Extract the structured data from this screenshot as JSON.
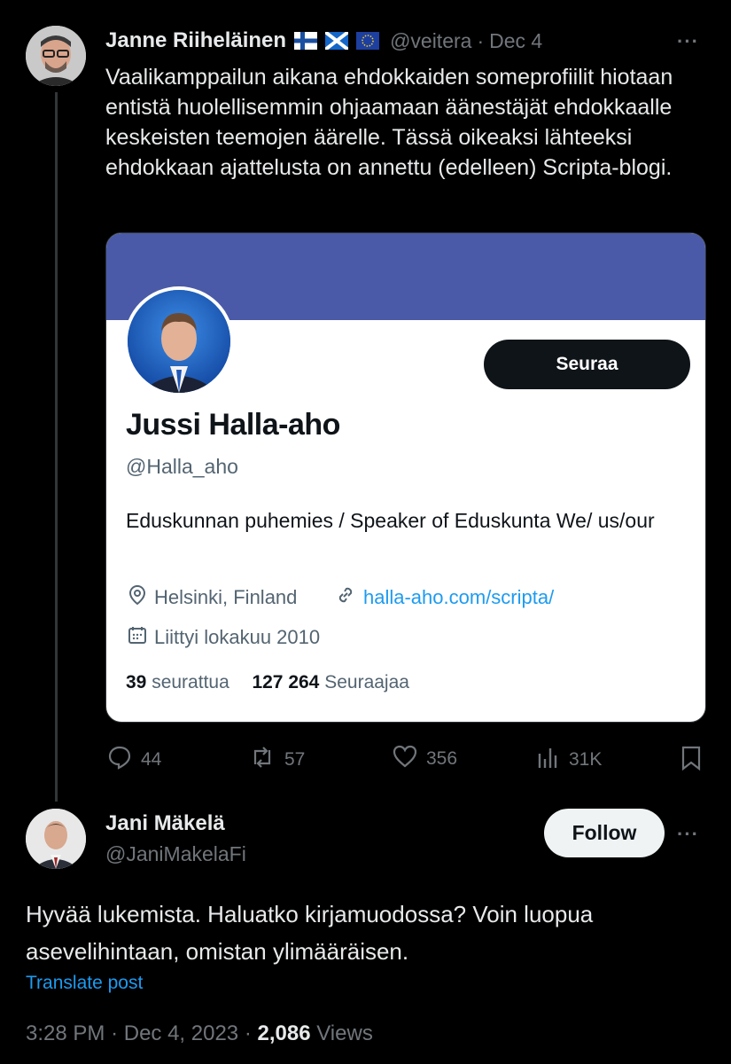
{
  "tweet": {
    "author_name": "Janne Riiheläinen",
    "author_handle": "@veitera",
    "separator": "·",
    "date": "Dec 4",
    "more_label": "···",
    "text": "Vaalikamppailun aikana ehdokkaiden someprofiilit hiotaan entistä  huolellisemmin ohjaamaan äänestäjät ehdokkaalle keskeisten teemojen äärelle. Tässä oikeaksi lähteeksi ehdokkaan ajattelusta on annettu (edelleen) Scripta-blogi.",
    "flags": [
      "finland-flag-icon",
      "scotland-flag-icon",
      "eu-flag-icon"
    ],
    "actions": {
      "replies": "44",
      "retweets": "57",
      "likes": "356",
      "views": "31K"
    }
  },
  "profile_card": {
    "follow_label": "Seuraa",
    "name": "Jussi Halla-aho",
    "handle": "@Halla_aho",
    "bio": "Eduskunnan puhemies / Speaker of Eduskunta We/ us/our",
    "location": "Helsinki, Finland",
    "website": "halla-aho.com/scripta/",
    "joined": "Liittyi lokakuu 2010",
    "following_count": "39",
    "following_label": "seurattua",
    "followers_count": "127 264",
    "followers_label": "Seuraajaa",
    "banner_color": "#4a5aa8"
  },
  "reply": {
    "author_name": "Jani Mäkelä",
    "author_handle": "@JaniMakelaFi",
    "follow_label": "Follow",
    "more_label": "···",
    "text": "Hyvää lukemista. Haluatko kirjamuodossa? Voin luopua asevelihintaan, omistan ylimääräisen.",
    "translate_label": "Translate post",
    "time": "3:28 PM",
    "sep1": "·",
    "date": "Dec 4, 2023",
    "sep2": "·",
    "views_count": "2,086",
    "views_label": "Views"
  },
  "colors": {
    "background": "#000000",
    "link": "#1d9bf0",
    "muted": "#71767b"
  }
}
